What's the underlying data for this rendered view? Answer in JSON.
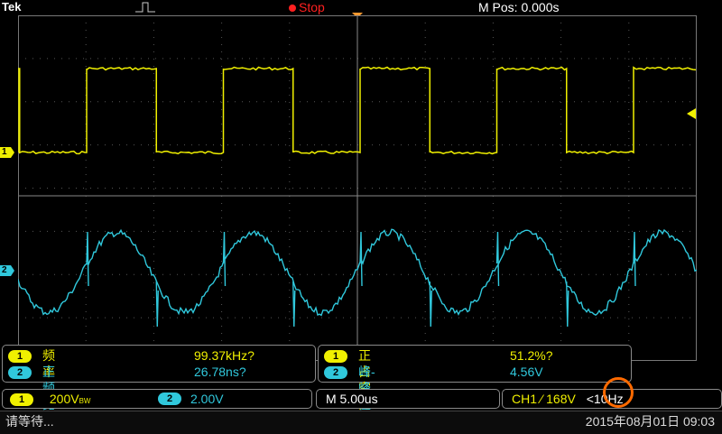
{
  "header": {
    "brand": "Tek",
    "run_state": "Stop",
    "m_pos": "M Pos: 0.000s"
  },
  "channels": {
    "ch1_marker": "1",
    "ch2_marker": "2",
    "ch1_color": "#f0f000",
    "ch2_color": "#30c8dc"
  },
  "measurements": {
    "left": [
      {
        "ch": "1",
        "label": "频率",
        "value": "99.37kHz?"
      },
      {
        "ch": "2",
        "label": "正频宽",
        "value": "26.78ns?"
      }
    ],
    "right": [
      {
        "ch": "1",
        "label": "正占空比",
        "value": "51.2%?"
      },
      {
        "ch": "2",
        "label": "峰-峰值",
        "value": "4.56V"
      }
    ]
  },
  "status": {
    "ch1_badge": "1",
    "ch1_scale": "200V",
    "ch1_bw": "BW",
    "ch2_badge": "2",
    "ch2_scale": "2.00V",
    "timebase": "M 5.00us",
    "trigger_source": "CH1",
    "trigger_level": "168V",
    "trigger_freq": "<10Hz"
  },
  "footer": {
    "message": "请等待...",
    "datetime": "2015年08月01日 09:03"
  }
}
